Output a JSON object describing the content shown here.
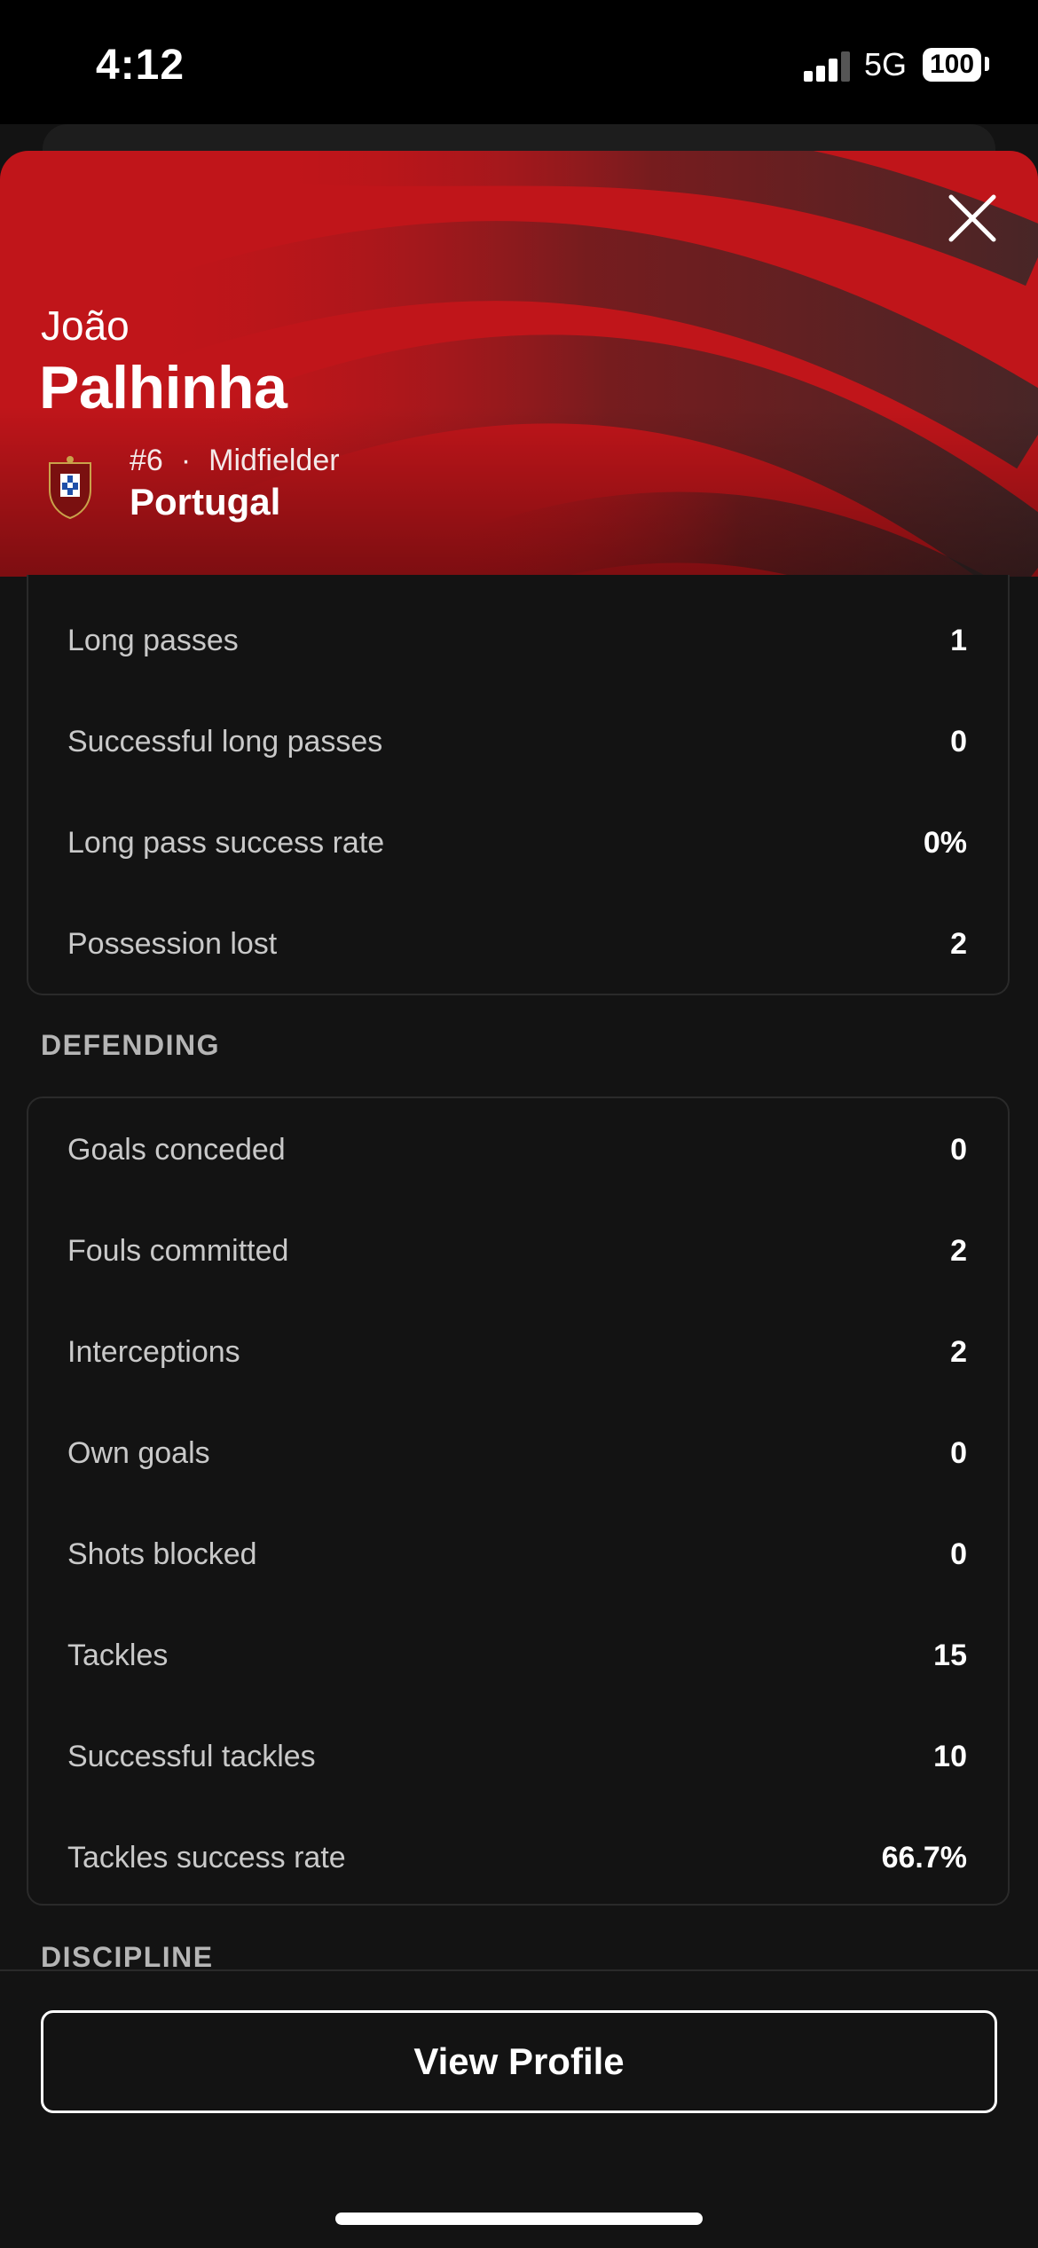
{
  "status_bar": {
    "time": "4:12",
    "network": "5G",
    "battery": "100"
  },
  "player": {
    "first_name": "João",
    "last_name": "Palhinha",
    "number": "#6",
    "position": "Midfielder",
    "team": "Portugal",
    "crest_icon": "portugal-crest-icon"
  },
  "colors": {
    "header_red": "#c0151a",
    "background": "#131313",
    "card_border": "#2a2a2a"
  },
  "passing_rows": [
    {
      "label": "Long passes",
      "value": "1"
    },
    {
      "label": "Successful long passes",
      "value": "0"
    },
    {
      "label": "Long pass success rate",
      "value": "0%"
    },
    {
      "label": "Possession lost",
      "value": "2"
    }
  ],
  "defending": {
    "title": "DEFENDING",
    "rows": [
      {
        "label": "Goals conceded",
        "value": "0"
      },
      {
        "label": "Fouls committed",
        "value": "2"
      },
      {
        "label": "Interceptions",
        "value": "2"
      },
      {
        "label": "Own goals",
        "value": "0"
      },
      {
        "label": "Shots blocked",
        "value": "0"
      },
      {
        "label": "Tackles",
        "value": "15"
      },
      {
        "label": "Successful tackles",
        "value": "10"
      },
      {
        "label": "Tackles success rate",
        "value": "66.7%"
      }
    ]
  },
  "discipline": {
    "title": "DISCIPLINE"
  },
  "actions": {
    "view_profile": "View Profile"
  }
}
